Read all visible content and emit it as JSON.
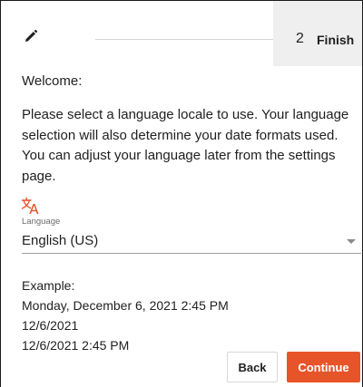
{
  "stepper": {
    "step1": {
      "icon": "pencil-icon"
    },
    "step2": {
      "number": "2",
      "label": "Finish"
    }
  },
  "content": {
    "welcome": "Welcome:",
    "description": "Please select a language locale to use. Your language selection will also determine your date formats used. You can adjust your language later from the settings page."
  },
  "language": {
    "icon": "translate-icon",
    "label": "Language",
    "value": "English (US)"
  },
  "example": {
    "heading": "Example:",
    "long_date": "Monday, December 6, 2021 2:45 PM",
    "short_date": "12/6/2021",
    "short_datetime": "12/6/2021 2:45 PM"
  },
  "actions": {
    "back_label": "Back",
    "continue_label": "Continue"
  },
  "colors": {
    "accent": "#e8542a",
    "step_active_bg": "#efefef"
  }
}
